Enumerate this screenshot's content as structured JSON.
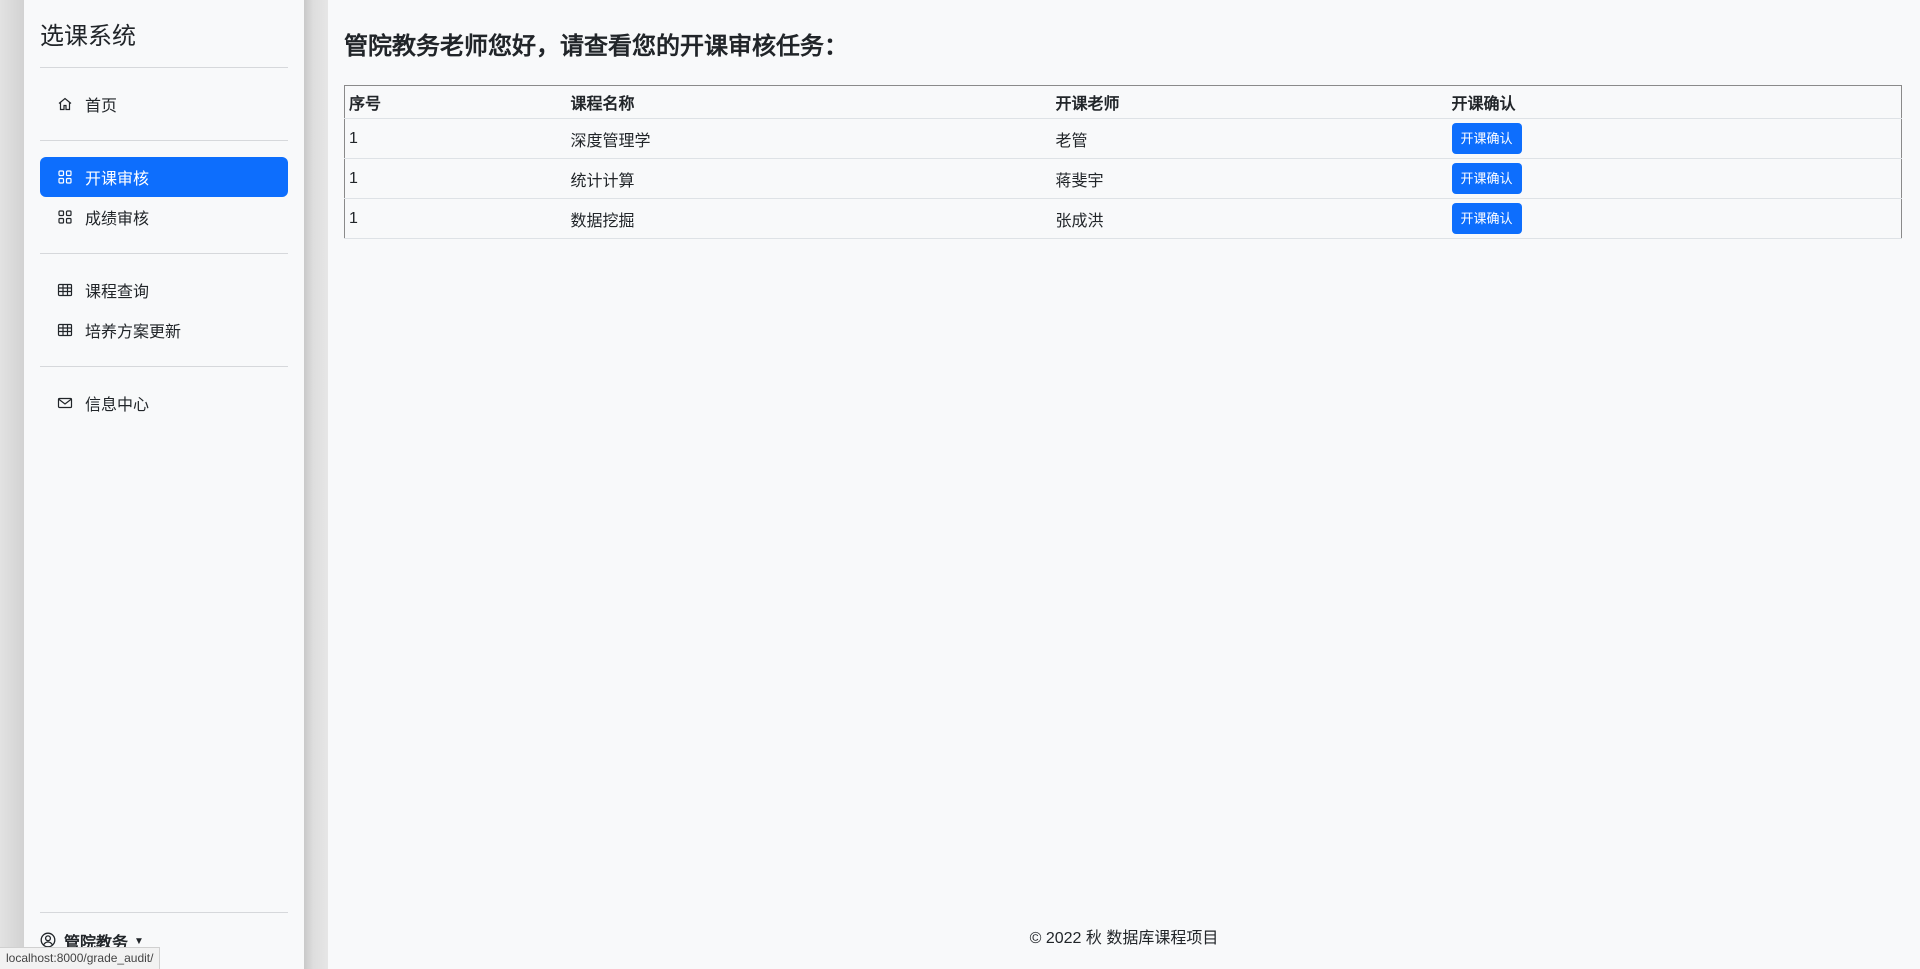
{
  "app": {
    "brand": "选课系统"
  },
  "sidebar": {
    "home": {
      "label": "首页",
      "icon": "house-icon"
    },
    "course_audit": {
      "label": "开课审核",
      "icon": "grid-icon",
      "active": true
    },
    "grade_audit": {
      "label": "成绩审核",
      "icon": "grid-icon"
    },
    "course_query": {
      "label": "课程查询",
      "icon": "table-icon"
    },
    "plan_update": {
      "label": "培养方案更新",
      "icon": "table-icon"
    },
    "messages": {
      "label": "信息中心",
      "icon": "envelope-icon"
    },
    "user": {
      "name": "管院教务",
      "icon": "user-circle-icon"
    }
  },
  "main": {
    "title": "管院教务老师您好，请查看您的开课审核任务：",
    "table": {
      "headers": [
        "序号",
        "课程名称",
        "开课老师",
        "开课确认"
      ],
      "rows": [
        {
          "no": "1",
          "course": "深度管理学",
          "teacher": "老管",
          "action": "开课确认"
        },
        {
          "no": "1",
          "course": "统计计算",
          "teacher": "蒋斐宇",
          "action": "开课确认"
        },
        {
          "no": "1",
          "course": "数据挖掘",
          "teacher": "张成洪",
          "action": "开课确认"
        }
      ]
    }
  },
  "footer": {
    "text": "© 2022 秋 数据库课程项目"
  },
  "status_bar": {
    "url": "localhost:8000/grade_audit/"
  },
  "colors": {
    "accent": "#0d6efd",
    "background": "#f8f9fa"
  }
}
